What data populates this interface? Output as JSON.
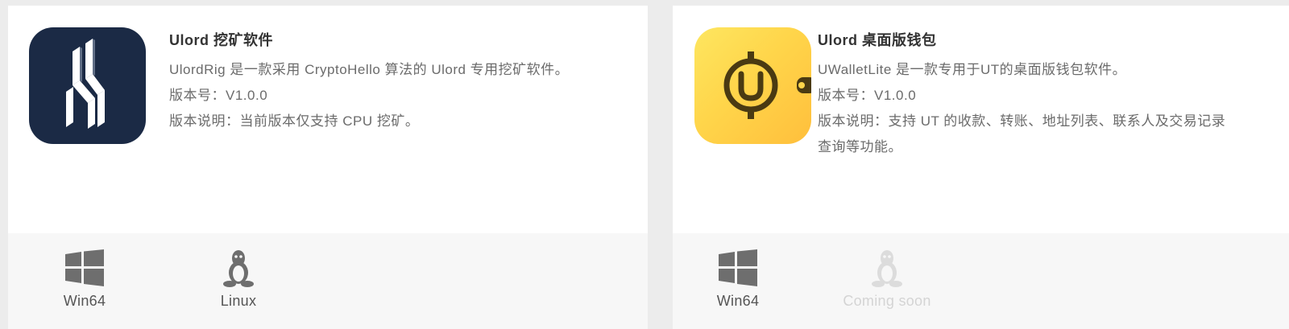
{
  "cards": [
    {
      "title": "Ulord 挖矿软件",
      "description": "UlordRig 是一款采用 CryptoHello 算法的 Ulord 专用挖矿软件。",
      "version": "版本号：V1.0.0",
      "notes": "版本说明：当前版本仅支持 CPU 挖矿。",
      "icon": "ulordrig-logo-icon",
      "downloads": [
        {
          "label": "Win64",
          "icon": "windows-icon",
          "available": true
        },
        {
          "label": "Linux",
          "icon": "linux-icon",
          "available": true
        }
      ]
    },
    {
      "title": "Ulord 桌面版钱包",
      "description": "UWalletLite 是一款专用于UT的桌面版钱包软件。",
      "version": "版本号：V1.0.0",
      "notes": "版本说明：支持 UT 的收款、转账、地址列表、联系人及交易记录",
      "notes_cont": "查询等功能。",
      "icon": "uwallet-logo-icon",
      "downloads": [
        {
          "label": "Win64",
          "icon": "windows-icon",
          "available": true
        },
        {
          "label": "Coming soon",
          "icon": "linux-icon",
          "available": false
        }
      ]
    }
  ],
  "colors": {
    "page_bg": "#ececec",
    "card_bg": "#ffffff",
    "download_bg": "#f7f7f7",
    "title": "#333333",
    "text": "#6b6b6b",
    "disabled": "#d4d4d4",
    "ulordrig_icon_bg": "#1b2a45",
    "uwallet_icon_bg": "#ffd54a",
    "uwallet_icon_fg": "#4a3a12"
  }
}
